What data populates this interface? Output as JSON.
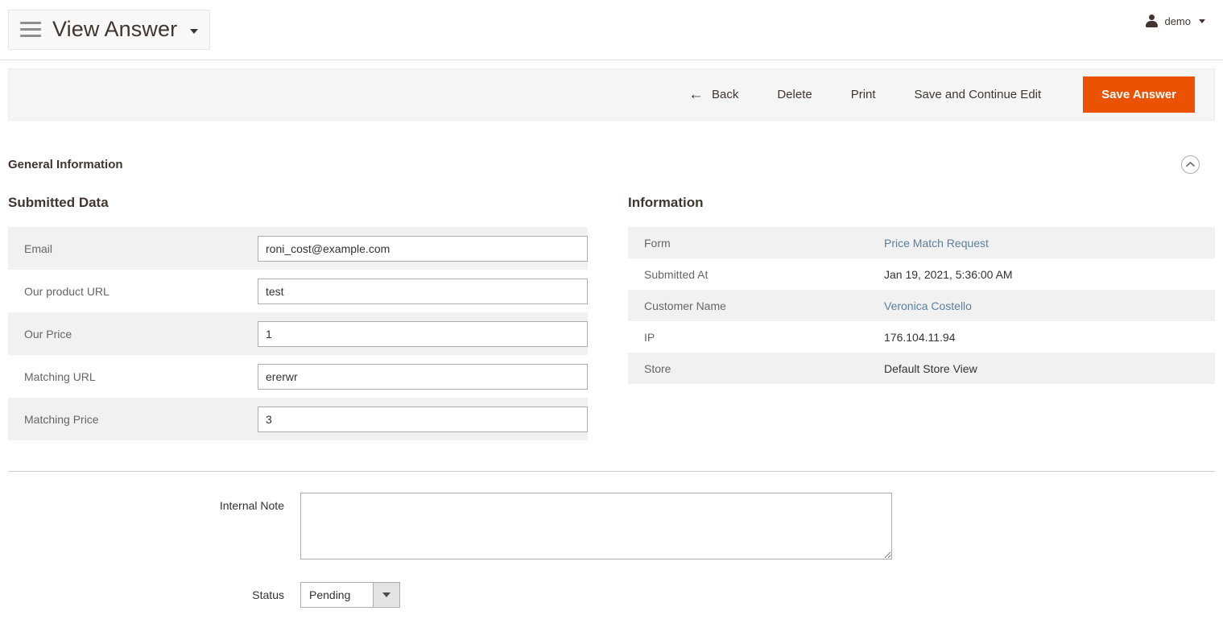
{
  "header": {
    "menu_icon": "hamburger-icon",
    "title": "View Answer",
    "title_caret": "▾",
    "user": {
      "icon": "user-icon",
      "name": "demo",
      "caret": "▾"
    }
  },
  "toolbar": {
    "back_arrow": "←",
    "back_label": "Back",
    "delete_label": "Delete",
    "print_label": "Print",
    "save_continue_label": "Save and Continue Edit",
    "save_label": "Save Answer",
    "primary_color": "#eb5202"
  },
  "section": {
    "title": "General Information",
    "collapse_icon": "chevron-up-icon"
  },
  "submitted_data": {
    "heading": "Submitted Data",
    "rows": [
      {
        "label": "Email",
        "value": "roni_cost@example.com"
      },
      {
        "label": "Our product URL",
        "value": "test"
      },
      {
        "label": "Our Price",
        "value": "1"
      },
      {
        "label": "Matching URL",
        "value": "ererwr"
      },
      {
        "label": "Matching Price",
        "value": "3"
      }
    ]
  },
  "information": {
    "heading": "Information",
    "rows": [
      {
        "label": "Form",
        "value": "Price Match Request",
        "link": true
      },
      {
        "label": "Submitted At",
        "value": "Jan 19, 2021, 5:36:00 AM",
        "link": false
      },
      {
        "label": "Customer Name",
        "value": "Veronica Costello",
        "link": true
      },
      {
        "label": "IP",
        "value": "176.104.11.94",
        "link": false
      },
      {
        "label": "Store",
        "value": "Default Store View",
        "link": false
      }
    ]
  },
  "form": {
    "internal_note_label": "Internal Note",
    "internal_note_value": "",
    "status_label": "Status",
    "status_value": "Pending",
    "status_options": [
      "Pending"
    ]
  },
  "colors": {
    "link": "#5b7f9e",
    "accent": "#eb5202",
    "row_alt": "#f1f1f1",
    "toolbar_bg": "#f5f5f5"
  }
}
